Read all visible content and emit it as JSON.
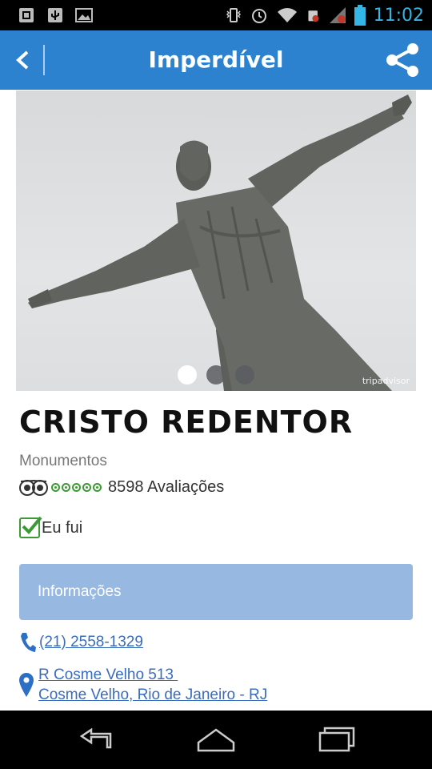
{
  "status_bar": {
    "time": "11:02",
    "icons": [
      "bbm-icon",
      "usb-icon",
      "image-icon",
      "vibrate-icon",
      "alarm-icon",
      "wifi-icon",
      "sim-icon",
      "signal-icon",
      "battery-icon"
    ]
  },
  "app_bar": {
    "title": "Imperdível",
    "back_icon": "back-chevron-icon",
    "share_icon": "share-icon",
    "color": "#2d82d0"
  },
  "hero": {
    "total_images": 3,
    "active_index": 0,
    "watermark": "tripadvisor"
  },
  "place": {
    "name": "CRISTO REDENTOR",
    "category": "Monumentos",
    "rating_bubbles": 5,
    "reviews_label": "8598 Avaliações",
    "been_there_label": "Eu fui",
    "been_there_checked": true
  },
  "info": {
    "header": "Informações",
    "phone": "(21) 2558-1329",
    "address_line1": "R Cosme Velho 513 ",
    "address_line2": "Cosme Velho, Rio de Janeiro - RJ"
  },
  "colors": {
    "accent": "#2d82d0",
    "info_bar": "#97b8e0",
    "link": "#3a6cbe",
    "green": "#3c9a34"
  },
  "nav_bar": [
    "back-nav-icon",
    "home-nav-icon",
    "recents-nav-icon"
  ]
}
